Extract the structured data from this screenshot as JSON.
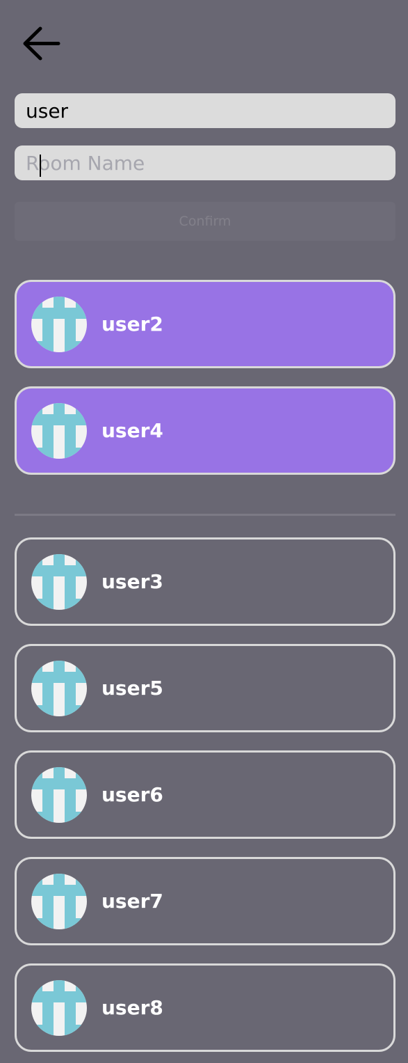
{
  "header": {
    "back_icon": "arrow-left-icon"
  },
  "form": {
    "username_value": "user",
    "room_name_value": "",
    "room_name_placeholder": "Room Name",
    "confirm_label": "Confirm"
  },
  "selected_users": [
    {
      "name": "user2",
      "avatar_icon": "identicon-avatar"
    },
    {
      "name": "user4",
      "avatar_icon": "identicon-avatar"
    }
  ],
  "other_users": [
    {
      "name": "user3",
      "avatar_icon": "identicon-avatar"
    },
    {
      "name": "user5",
      "avatar_icon": "identicon-avatar"
    },
    {
      "name": "user6",
      "avatar_icon": "identicon-avatar"
    },
    {
      "name": "user7",
      "avatar_icon": "identicon-avatar"
    },
    {
      "name": "user8",
      "avatar_icon": "identicon-avatar"
    }
  ],
  "colors": {
    "background": "#696773",
    "selected_card": "#9873e5",
    "card_border": "#d9d9d9",
    "field_background": "#dcdcdc",
    "avatar_tile": "#7ac8d6",
    "avatar_background": "#f2f2f2"
  }
}
